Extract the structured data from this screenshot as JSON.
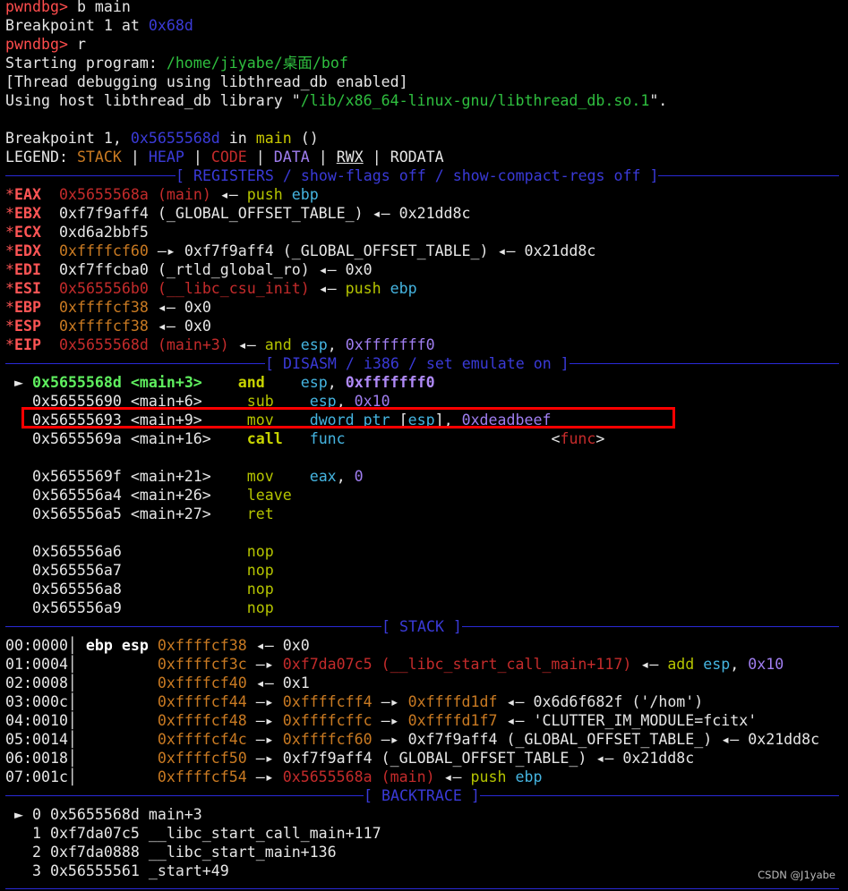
{
  "terminal": {
    "lines": [
      [
        [
          "pwndbg> ",
          "r"
        ],
        [
          "b main",
          "w"
        ]
      ],
      [
        [
          "Breakpoint 1 at ",
          "w"
        ],
        [
          "0x68d",
          "b"
        ]
      ],
      [
        [
          "pwndbg> ",
          "r"
        ],
        [
          "r",
          "w"
        ]
      ],
      [
        [
          "Starting program: ",
          "w"
        ],
        [
          "/home/jiyabe/桌面/bof",
          "g"
        ]
      ],
      [
        [
          "[Thread debugging using libthread_db enabled]",
          "w"
        ]
      ],
      [
        [
          "Using host libthread_db library \"",
          "w"
        ],
        [
          "/lib/x86_64-linux-gnu/libthread_db.so.1",
          "g"
        ],
        [
          "\".",
          "w"
        ]
      ],
      [],
      [
        [
          "Breakpoint 1, ",
          "w"
        ],
        [
          "0x5655568d",
          "b"
        ],
        [
          " in ",
          "w"
        ],
        [
          "main",
          "y"
        ],
        [
          " ()",
          "w"
        ]
      ],
      [
        [
          "LEGEND: ",
          "w"
        ],
        [
          "STACK",
          "o"
        ],
        [
          " | ",
          "w"
        ],
        [
          "HEAP",
          "b"
        ],
        [
          " | ",
          "w"
        ],
        [
          "CODE",
          "dr"
        ],
        [
          " | ",
          "w"
        ],
        [
          "DATA",
          "p"
        ],
        [
          " | ",
          "w"
        ],
        [
          "RWX",
          "u"
        ],
        [
          " | ",
          "w"
        ],
        [
          "RODATA",
          "w"
        ]
      ],
      {
        "sep": "[ REGISTERS / show-flags off / show-compact-regs off ]"
      },
      [
        [
          "*",
          "star"
        ],
        [
          "EAX",
          "reg"
        ],
        [
          "  ",
          "w"
        ],
        [
          "0x5655568a (main)",
          "dr"
        ],
        [
          " ◂— ",
          "w"
        ],
        [
          "push",
          "yg"
        ],
        [
          " ebp",
          "c"
        ]
      ],
      [
        [
          "*",
          "star"
        ],
        [
          "EBX",
          "reg"
        ],
        [
          "  0xf7f9aff4 (_GLOBAL_OFFSET_TABLE_) ◂— 0x21dd8c",
          "w"
        ]
      ],
      [
        [
          "*",
          "star"
        ],
        [
          "ECX",
          "reg"
        ],
        [
          "  0xd6a2bbf5",
          "w"
        ]
      ],
      [
        [
          "*",
          "star"
        ],
        [
          "EDX",
          "reg"
        ],
        [
          "  ",
          "w"
        ],
        [
          "0xffffcf60",
          "o"
        ],
        [
          " —▸ 0xf7f9aff4 (_GLOBAL_OFFSET_TABLE_) ◂— 0x21dd8c",
          "w"
        ]
      ],
      [
        [
          "*",
          "star"
        ],
        [
          "EDI",
          "reg"
        ],
        [
          "  0xf7ffcba0 (_rtld_global_ro) ◂— 0x0",
          "w"
        ]
      ],
      [
        [
          "*",
          "star"
        ],
        [
          "ESI",
          "reg"
        ],
        [
          "  ",
          "w"
        ],
        [
          "0x565556b0 (__libc_csu_init)",
          "dr"
        ],
        [
          " ◂— ",
          "w"
        ],
        [
          "push",
          "yg"
        ],
        [
          " ebp",
          "c"
        ]
      ],
      [
        [
          "*",
          "star"
        ],
        [
          "EBP",
          "reg"
        ],
        [
          "  ",
          "w"
        ],
        [
          "0xffffcf38",
          "o"
        ],
        [
          " ◂— 0x0",
          "w"
        ]
      ],
      [
        [
          "*",
          "star"
        ],
        [
          "ESP",
          "reg"
        ],
        [
          "  ",
          "w"
        ],
        [
          "0xffffcf38",
          "o"
        ],
        [
          " ◂— 0x0",
          "w"
        ]
      ],
      [
        [
          "*",
          "star"
        ],
        [
          "EIP",
          "reg"
        ],
        [
          "  ",
          "w"
        ],
        [
          "0x5655568d (main+3)",
          "dr"
        ],
        [
          " ◂— ",
          "w"
        ],
        [
          "and",
          "yg"
        ],
        [
          " esp",
          "c"
        ],
        [
          ", ",
          "w"
        ],
        [
          "0xfffffff0",
          "p"
        ]
      ],
      {
        "sep": "[ DISASM / i386 / set emulate on ]"
      },
      [
        [
          " ► ",
          "w"
        ],
        [
          "0x5655568d <main+3>",
          "gb"
        ],
        [
          "    ",
          "w"
        ],
        [
          "and",
          "ygb"
        ],
        [
          "    ",
          "w"
        ],
        [
          "esp",
          "c"
        ],
        [
          ", ",
          "w"
        ],
        [
          "0xfffffff0",
          "pb"
        ]
      ],
      [
        [
          "   0x56555690 <main+6>     ",
          "w"
        ],
        [
          "sub",
          "yg"
        ],
        [
          "    ",
          "w"
        ],
        [
          "esp",
          "c"
        ],
        [
          ", ",
          "w"
        ],
        [
          "0x10",
          "p"
        ]
      ],
      [
        [
          "   0x56555693 <main+9>     ",
          "w"
        ],
        [
          "mov",
          "yg"
        ],
        [
          "    ",
          "w"
        ],
        [
          "dword ptr ",
          "c"
        ],
        [
          "[",
          "w"
        ],
        [
          "esp",
          "c"
        ],
        [
          "], ",
          "w"
        ],
        [
          "0xdeadbeef",
          "p"
        ]
      ],
      [
        [
          "   0x5655569a <main+16>    ",
          "w"
        ],
        [
          "call",
          "ygb"
        ],
        [
          "   ",
          "w"
        ],
        [
          "func",
          "c"
        ],
        [
          "                       <",
          "w"
        ],
        [
          "func",
          "dr"
        ],
        [
          ">",
          "w"
        ]
      ],
      [],
      [
        [
          "   0x5655569f <main+21>    ",
          "w"
        ],
        [
          "mov",
          "yg"
        ],
        [
          "    ",
          "w"
        ],
        [
          "eax",
          "c"
        ],
        [
          ", ",
          "w"
        ],
        [
          "0",
          "p"
        ]
      ],
      [
        [
          "   0x565556a4 <main+26>    ",
          "w"
        ],
        [
          "leave",
          "yg"
        ]
      ],
      [
        [
          "   0x565556a5 <main+27>    ",
          "w"
        ],
        [
          "ret",
          "yg"
        ]
      ],
      [],
      [
        [
          "   0x565556a6              ",
          "w"
        ],
        [
          "nop",
          "yg"
        ]
      ],
      [
        [
          "   0x565556a7              ",
          "w"
        ],
        [
          "nop",
          "yg"
        ]
      ],
      [
        [
          "   0x565556a8              ",
          "w"
        ],
        [
          "nop",
          "yg"
        ]
      ],
      [
        [
          "   0x565556a9              ",
          "w"
        ],
        [
          "nop",
          "yg"
        ]
      ],
      {
        "sep": "[ STACK ]"
      },
      [
        [
          "00:0000│ ",
          "w"
        ],
        [
          "ebp esp",
          "bw"
        ],
        [
          " ",
          "w"
        ],
        [
          "0xffffcf38",
          "o"
        ],
        [
          " ◂— 0x0",
          "w"
        ]
      ],
      [
        [
          "01:0004│         ",
          "w"
        ],
        [
          "0xffffcf3c",
          "o"
        ],
        [
          " —▸ ",
          "w"
        ],
        [
          "0xf7da07c5 (__libc_start_call_main+117)",
          "dr"
        ],
        [
          " ◂— ",
          "w"
        ],
        [
          "add",
          "yg"
        ],
        [
          " esp",
          "c"
        ],
        [
          ", ",
          "w"
        ],
        [
          "0x10",
          "p"
        ]
      ],
      [
        [
          "02:0008│         ",
          "w"
        ],
        [
          "0xffffcf40",
          "o"
        ],
        [
          " ◂— 0x1",
          "w"
        ]
      ],
      [
        [
          "03:000c│         ",
          "w"
        ],
        [
          "0xffffcf44",
          "o"
        ],
        [
          " —▸ ",
          "w"
        ],
        [
          "0xffffcff4",
          "o"
        ],
        [
          " —▸ ",
          "w"
        ],
        [
          "0xffffd1df",
          "o"
        ],
        [
          " ◂— 0x6d6f682f ('/hom')",
          "w"
        ]
      ],
      [
        [
          "04:0010│         ",
          "w"
        ],
        [
          "0xffffcf48",
          "o"
        ],
        [
          " —▸ ",
          "w"
        ],
        [
          "0xffffcffc",
          "o"
        ],
        [
          " —▸ ",
          "w"
        ],
        [
          "0xffffd1f7",
          "o"
        ],
        [
          " ◂— 'CLUTTER_IM_MODULE=fcitx'",
          "w"
        ]
      ],
      [
        [
          "05:0014│         ",
          "w"
        ],
        [
          "0xffffcf4c",
          "o"
        ],
        [
          " —▸ ",
          "w"
        ],
        [
          "0xffffcf60",
          "o"
        ],
        [
          " —▸ 0xf7f9aff4 (_GLOBAL_OFFSET_TABLE_) ◂— 0x21dd8c",
          "w"
        ]
      ],
      [
        [
          "06:0018│         ",
          "w"
        ],
        [
          "0xffffcf50",
          "o"
        ],
        [
          " —▸ 0xf7f9aff4 (_GLOBAL_OFFSET_TABLE_) ◂— 0x21dd8c",
          "w"
        ]
      ],
      [
        [
          "07:001c│         ",
          "w"
        ],
        [
          "0xffffcf54",
          "o"
        ],
        [
          " —▸ ",
          "w"
        ],
        [
          "0x5655568a (main)",
          "dr"
        ],
        [
          " ◂— ",
          "w"
        ],
        [
          "push",
          "yg"
        ],
        [
          " ebp",
          "c"
        ]
      ],
      {
        "sep": "[ BACKTRACE ]"
      },
      [
        [
          " ► 0 0x5655568d main+3",
          "w"
        ]
      ],
      [
        [
          "   1 0xf7da07c5 __libc_start_call_main+117",
          "w"
        ]
      ],
      [
        [
          "   2 0xf7da0888 __libc_start_main+136",
          "w"
        ]
      ],
      [
        [
          "   3 0x56555561 _start+49",
          "w"
        ]
      ]
    ]
  },
  "watermark": "CSDN @J1yabe",
  "colors": {
    "background": "#000000",
    "prompt": "#ff4d4d",
    "separator": "#2a2ad8",
    "highlight_box": "#ff0000",
    "stack": "#c97a22",
    "code": "#c42b2b",
    "data": "#a07ef0",
    "heap": "#3b3bd8"
  }
}
